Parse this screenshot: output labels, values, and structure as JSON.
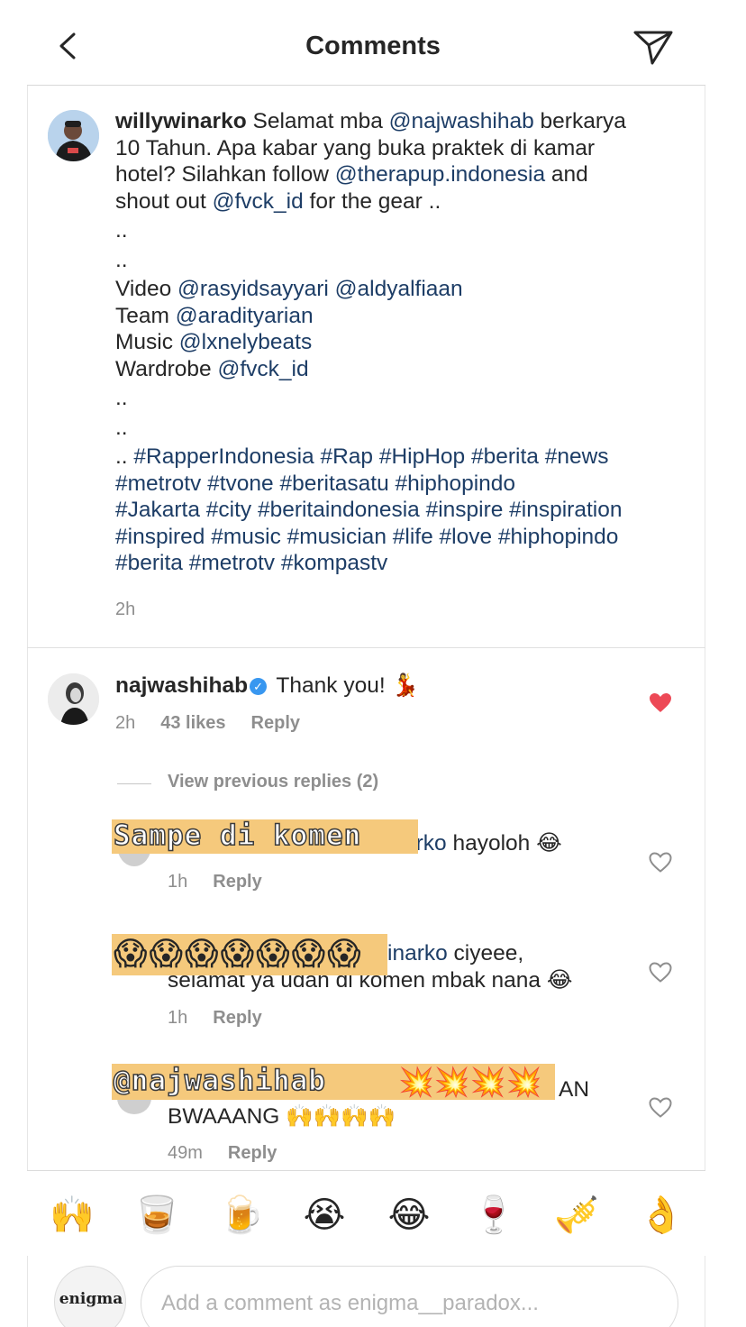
{
  "header": {
    "title": "Comments",
    "back_icon": "chevron-left-icon",
    "share_icon": "paper-plane-icon"
  },
  "caption": {
    "username": "willywinarko",
    "lines": [
      [
        {
          "t": "u",
          "v": "willywinarko"
        },
        {
          "t": "x",
          "v": " Selamat mba "
        },
        {
          "t": "m",
          "v": "@najwashihab"
        },
        {
          "t": "x",
          "v": " berkarya"
        }
      ],
      [
        {
          "t": "x",
          "v": "10 Tahun. Apa kabar yang buka praktek di kamar"
        }
      ],
      [
        {
          "t": "x",
          "v": "hotel? Silahkan follow "
        },
        {
          "t": "m",
          "v": "@therapup.indonesia"
        },
        {
          "t": "x",
          "v": " and"
        }
      ],
      [
        {
          "t": "x",
          "v": "shout out "
        },
        {
          "t": "m",
          "v": "@fvck_id"
        },
        {
          "t": "x",
          "v": " for the gear .."
        }
      ],
      [
        {
          "t": "x",
          "v": ".."
        }
      ],
      [
        {
          "t": "x",
          "v": ".."
        }
      ],
      [
        {
          "t": "x",
          "v": "Video "
        },
        {
          "t": "m",
          "v": "@rasyidsayyari"
        },
        {
          "t": "x",
          "v": " "
        },
        {
          "t": "m",
          "v": "@aldyalfiaan"
        }
      ],
      [
        {
          "t": "x",
          "v": "Team "
        },
        {
          "t": "m",
          "v": "@aradityarian"
        }
      ],
      [
        {
          "t": "x",
          "v": "Music "
        },
        {
          "t": "m",
          "v": "@lxnelybeats"
        }
      ],
      [
        {
          "t": "x",
          "v": "Wardrobe "
        },
        {
          "t": "m",
          "v": "@fvck_id"
        }
      ],
      [
        {
          "t": "x",
          "v": ".."
        }
      ],
      [
        {
          "t": "x",
          "v": ".."
        }
      ],
      [
        {
          "t": "x",
          "v": ".. "
        },
        {
          "t": "m",
          "v": "#RapperIndonesia #Rap #HipHop #berita #news"
        }
      ],
      [
        {
          "t": "m",
          "v": "#metrotv #tvone #beritasatu #hiphopindo"
        }
      ],
      [
        {
          "t": "m",
          "v": "#Jakarta #city #beritaindonesia #inspire #inspiration"
        }
      ],
      [
        {
          "t": "m",
          "v": "#inspired #music #musician #life #love #hiphopindo"
        }
      ],
      [
        {
          "t": "m",
          "v": "#berita #metrotv #kompastv"
        }
      ]
    ],
    "time": "2h"
  },
  "comment": {
    "username": "najwashihab",
    "verified_icon": "verified-badge-icon",
    "text": "Thank you!",
    "emoji": "💃",
    "time": "2h",
    "likes": "43 likes",
    "reply_label": "Reply",
    "liked": true
  },
  "view_previous": "View previous replies (2)",
  "replies": [
    {
      "line1_mention": "arko",
      "line1_text": " hayoloh 😂",
      "line2": "",
      "time": "1h",
      "reply_label": "Reply",
      "sticker": "Sampe di komen"
    },
    {
      "line1_mention": "inarko",
      "line1_text": " ciyeee,",
      "line2": "selamat ya udah di komen mbak nana 😂",
      "time": "1h",
      "reply_label": "Reply",
      "sticker": "😱😱😱😱😱😱😱"
    },
    {
      "line1_mention": "",
      "line1_text": "AN",
      "line2": "BWAAANG 🙌🙌🙌🙌",
      "time": "49m",
      "reply_label": "Reply",
      "sticker": "@najwashihab",
      "sticker_emoji": "💥💥💥💥"
    }
  ],
  "emoji_bar": [
    "🙌",
    "🥃",
    "🍺",
    "😭",
    "😂",
    "🍷",
    "🎺",
    "👌"
  ],
  "composer": {
    "avatar_text": "enigma",
    "placeholder": "Add a comment as enigma__paradox..."
  },
  "colors": {
    "mention": "#1d3d66",
    "meta": "#8e8e8e",
    "heart_liked": "#ed4956",
    "verified": "#3897f0",
    "sticker_bg": "#f5c97c"
  }
}
